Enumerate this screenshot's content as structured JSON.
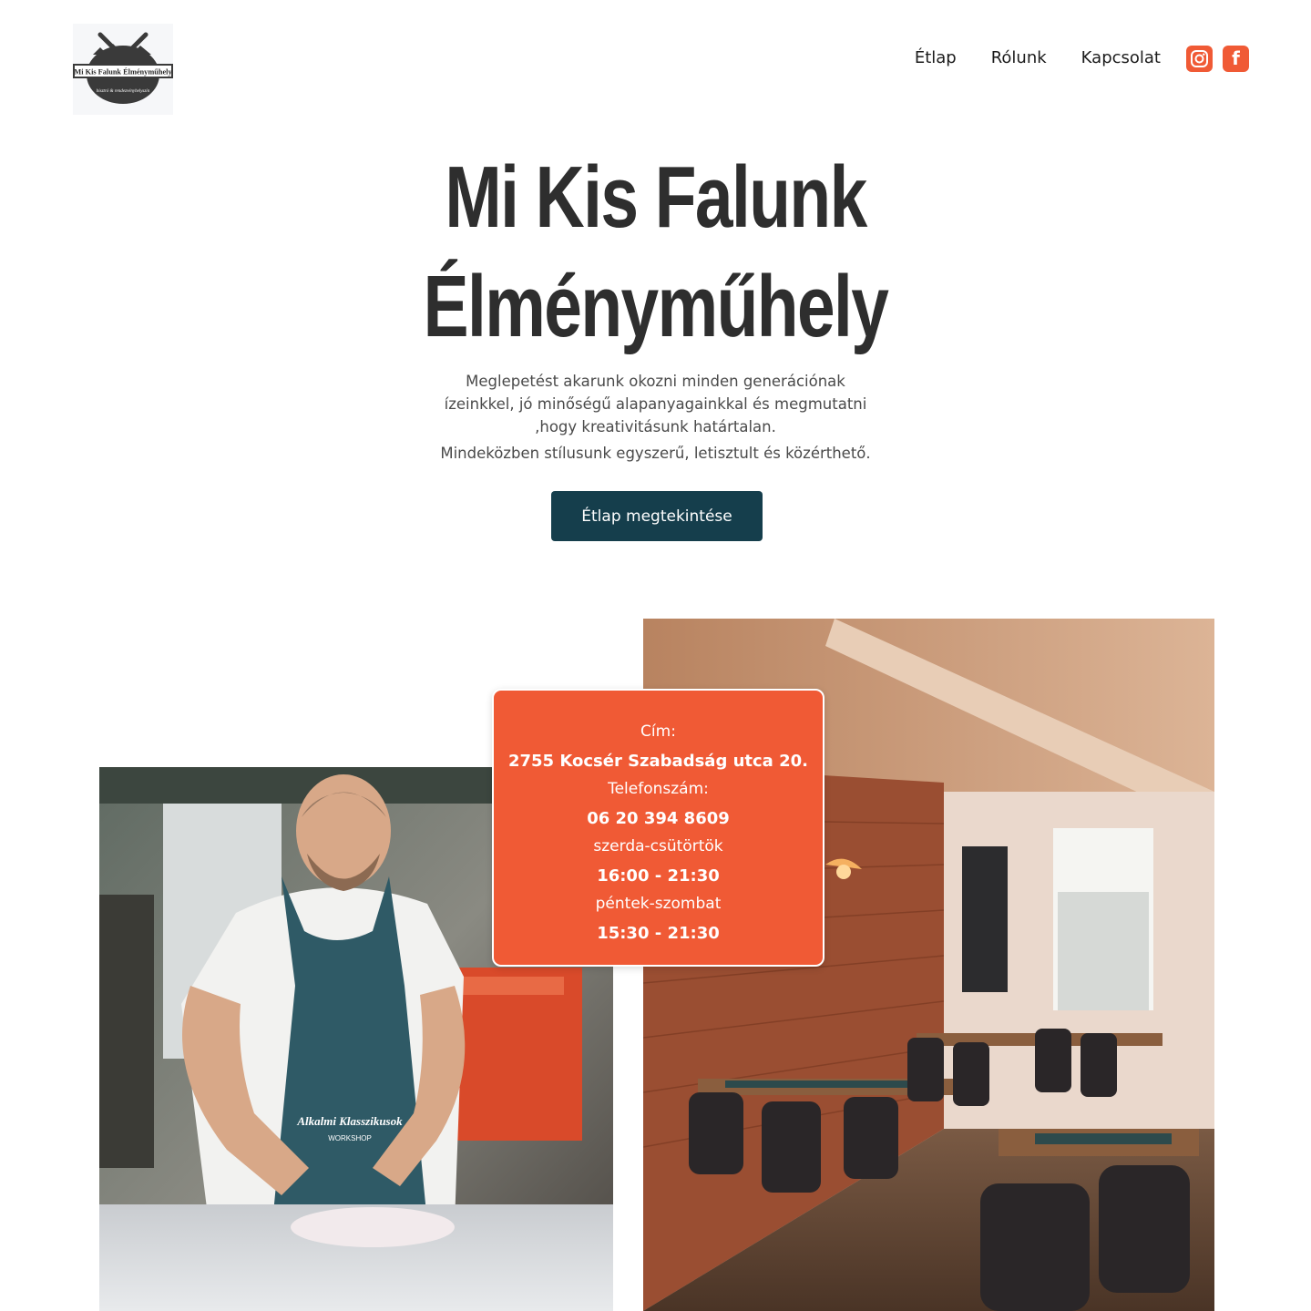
{
  "brand": {
    "logo_text": "Mi Kis Falunk Élményműhely",
    "logo_subtext": "bisztró & rendezvényhelyszín"
  },
  "nav": {
    "items": [
      {
        "label": "Étlap"
      },
      {
        "label": "Rólunk"
      },
      {
        "label": "Kapcsolat"
      }
    ],
    "social": [
      {
        "icon": "instagram-icon"
      },
      {
        "icon": "facebook-icon",
        "glyph": "f"
      }
    ]
  },
  "hero": {
    "title_line1": "Mi Kis Falunk",
    "title_line2": "Élményműhely",
    "desc1_line1": "Meglepetést akarunk okozni minden generációnak",
    "desc1_line2": "ízeinkkel, jó minőségű alapanyagainkkal és megmutatni",
    "desc1_line3": ",hogy kreativitásunk határtalan.",
    "desc2": "Mindeközben stílusunk egyszerű, letisztult és közérthető.",
    "cta_label": "Étlap megtekintése"
  },
  "info": {
    "address_label": "Cím:",
    "address": "2755 Kocsér Szabadság utca 20.",
    "phone_label": "Telefonszám:",
    "phone": "06 20 394 8609",
    "days1": "szerda-csütörtök",
    "hours1": "16:00 - 21:30",
    "days2": "péntek-szombat",
    "hours2": "15:30 - 21:30"
  },
  "photos": {
    "chef_apron_text1": "Alkalmi Klasszikusok",
    "chef_apron_text2": "WORKSHOP"
  },
  "colors": {
    "accent": "#f05a35",
    "button": "#153e4c",
    "text": "#2e2e2e"
  }
}
